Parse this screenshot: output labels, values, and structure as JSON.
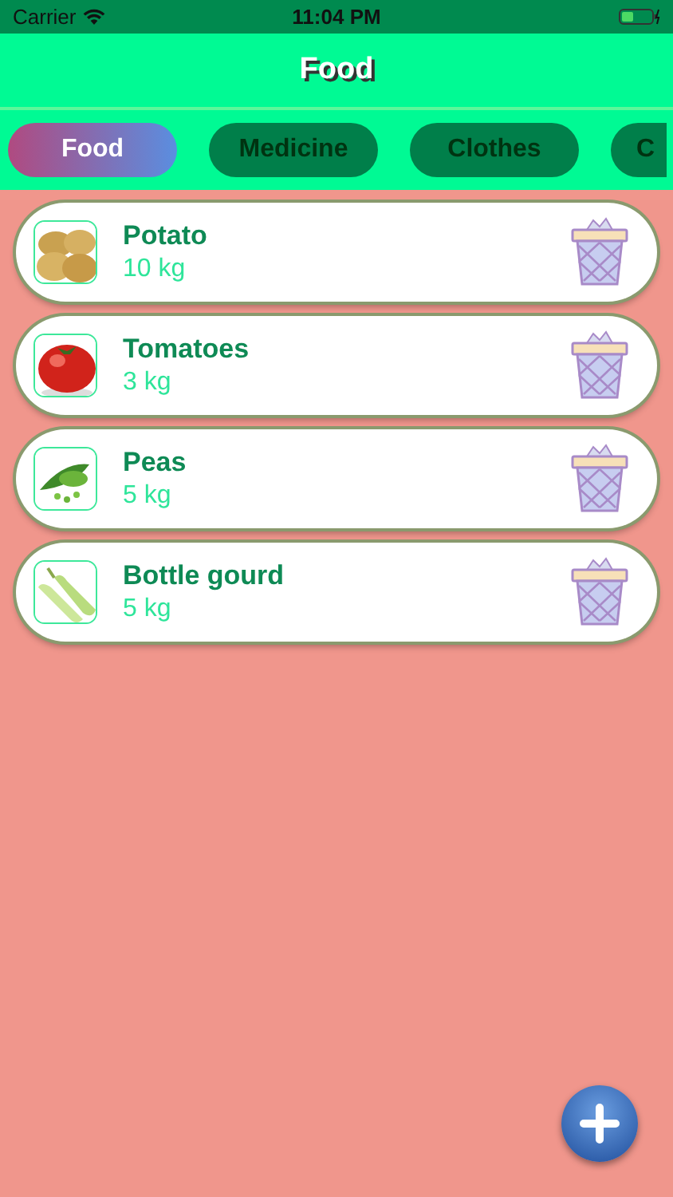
{
  "status_bar": {
    "carrier": "Carrier",
    "time": "11:04 PM"
  },
  "title": "Food",
  "tabs": [
    {
      "label": "Food",
      "selected": true
    },
    {
      "label": "Medicine",
      "selected": false
    },
    {
      "label": "Clothes",
      "selected": false
    },
    {
      "label": "C",
      "selected": false
    }
  ],
  "items": [
    {
      "name": "Potato",
      "quantity": "10 kg"
    },
    {
      "name": "Tomatoes",
      "quantity": "3 kg"
    },
    {
      "name": "Peas",
      "quantity": "5 kg"
    },
    {
      "name": "Bottle gourd",
      "quantity": "5 kg"
    }
  ]
}
